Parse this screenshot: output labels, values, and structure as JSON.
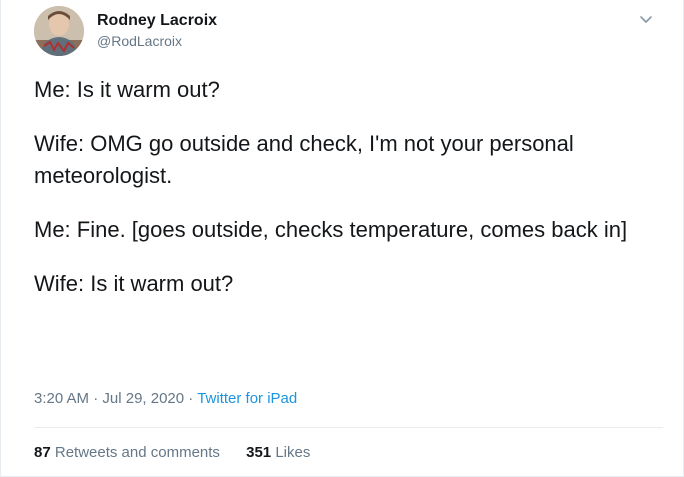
{
  "author": {
    "display_name": "Rodney Lacroix",
    "handle": "@RodLacroix",
    "avatar_icon": "profile-photo"
  },
  "menu_icon": "chevron-down-icon",
  "tweet": {
    "paragraphs": [
      "Me: Is it warm out?",
      "Wife: OMG go outside and check, I'm not your personal meteorologist.",
      "Me: Fine. [goes outside, checks temperature, comes back in]",
      "Wife: Is it warm out?"
    ]
  },
  "meta": {
    "time": "3:20 AM",
    "separator": "·",
    "date": "Jul 29, 2020",
    "source": "Twitter for iPad"
  },
  "stats": {
    "retweets_count": "87",
    "retweets_label": "Retweets and comments",
    "likes_count": "351",
    "likes_label": "Likes"
  },
  "colors": {
    "text": "#14171a",
    "muted": "#657786",
    "link": "#1b95e0",
    "border": "#e6ecf0"
  }
}
